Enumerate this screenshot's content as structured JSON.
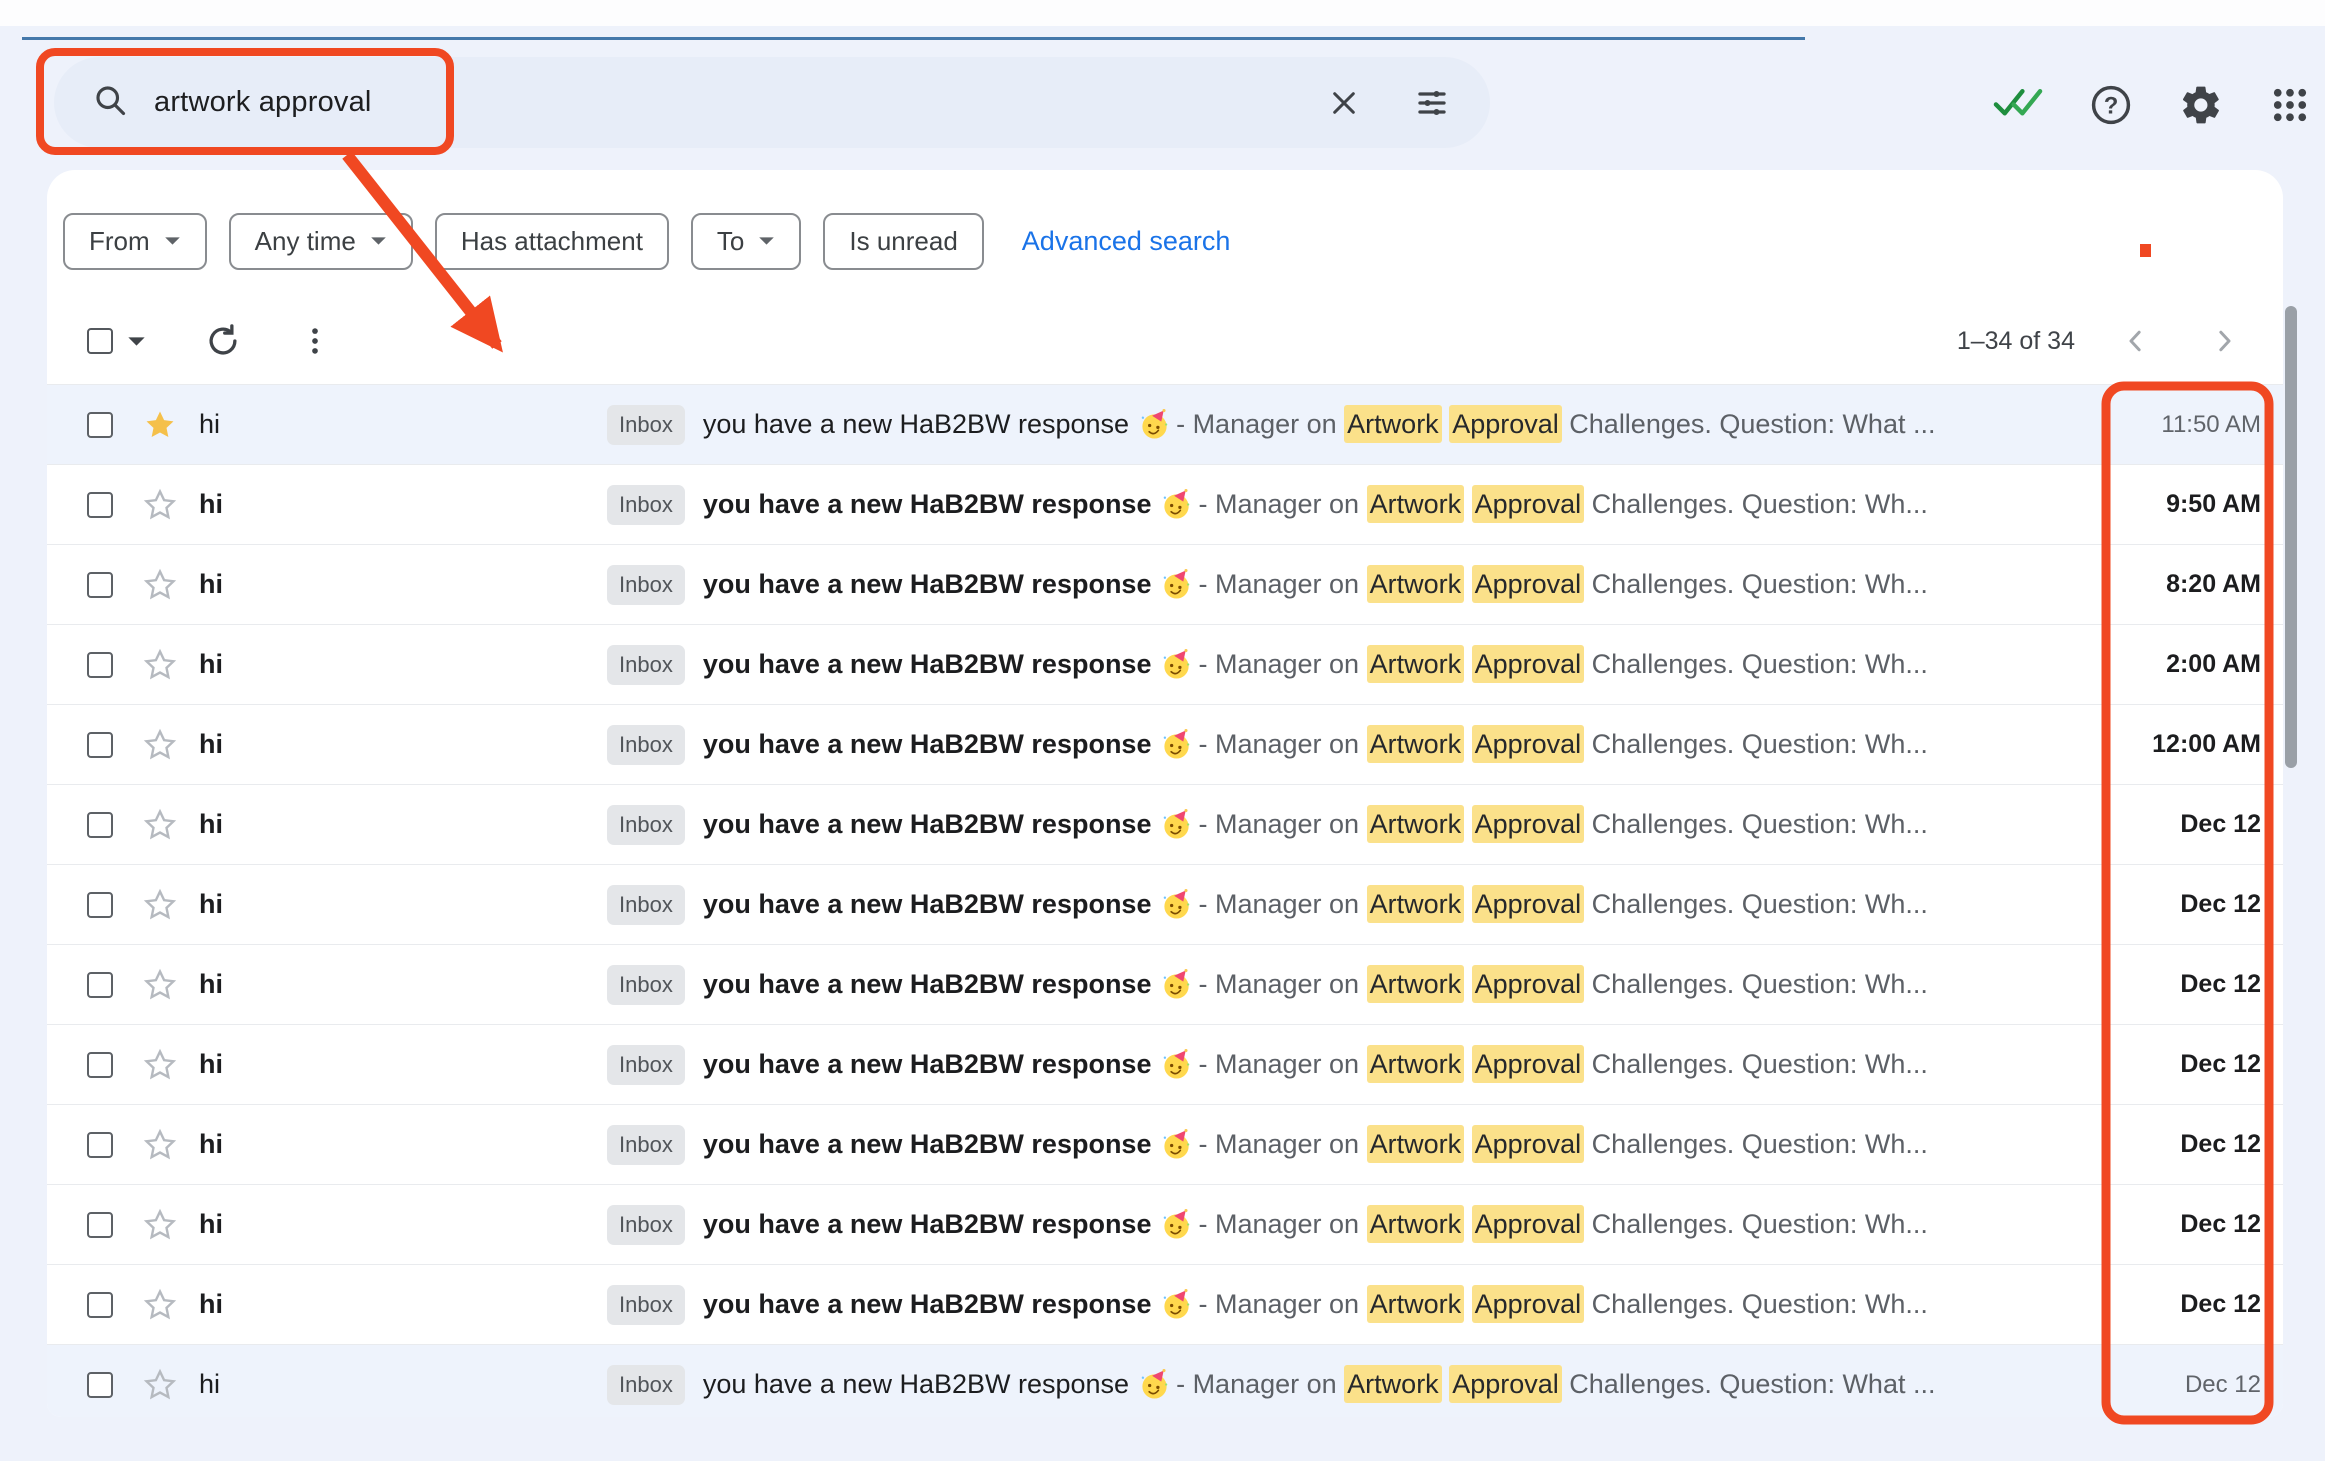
{
  "colors": {
    "accent_red": "#f04822",
    "highlight_yellow": "#fbe18a",
    "link_blue": "#1a73e8",
    "read_row_bg": "#eef3fc"
  },
  "search": {
    "query": "artwork approval",
    "icons": [
      "search-icon",
      "clear-icon",
      "search-options-sliders-icon"
    ]
  },
  "header": {
    "icons": [
      "double-checkmark-icon",
      "help-icon",
      "settings-gear-icon",
      "apps-grid-icon"
    ],
    "help_glyph": "?"
  },
  "chips": [
    {
      "label": "From",
      "dropdown": true
    },
    {
      "label": "Any time",
      "dropdown": true
    },
    {
      "label": "Has attachment",
      "dropdown": false
    },
    {
      "label": "To",
      "dropdown": true
    },
    {
      "label": "Is unread",
      "dropdown": false
    }
  ],
  "advanced_search_label": "Advanced search",
  "toolbar": {
    "pagination": "1–34 of 34",
    "icons": [
      "select-checkbox",
      "select-dropdown-caret",
      "refresh-icon",
      "more-options-icon",
      "prev-page-chevron",
      "next-page-chevron"
    ]
  },
  "emails": [
    {
      "sender": "hi",
      "label": "Inbox",
      "subject": "you have a new HaB2BW response",
      "emoji": "party-face",
      "snippet_prefix": "- Manager on ",
      "highlight1": "Artwork",
      "highlight2": "Approval",
      "snippet_suffix": " Challenges. Question: What ...",
      "time": "11:50 AM",
      "unread": false,
      "starred": true
    },
    {
      "sender": "hi",
      "label": "Inbox",
      "subject": "you have a new HaB2BW response",
      "emoji": "party-face",
      "snippet_prefix": "- Manager on ",
      "highlight1": "Artwork",
      "highlight2": "Approval",
      "snippet_suffix": " Challenges. Question: Wh...",
      "time": "9:50 AM",
      "unread": true,
      "starred": false
    },
    {
      "sender": "hi",
      "label": "Inbox",
      "subject": "you have a new HaB2BW response",
      "emoji": "party-face",
      "snippet_prefix": "- Manager on ",
      "highlight1": "Artwork",
      "highlight2": "Approval",
      "snippet_suffix": " Challenges. Question: Wh...",
      "time": "8:20 AM",
      "unread": true,
      "starred": false
    },
    {
      "sender": "hi",
      "label": "Inbox",
      "subject": "you have a new HaB2BW response",
      "emoji": "party-face",
      "snippet_prefix": "- Manager on ",
      "highlight1": "Artwork",
      "highlight2": "Approval",
      "snippet_suffix": " Challenges. Question: Wh...",
      "time": "2:00 AM",
      "unread": true,
      "starred": false
    },
    {
      "sender": "hi",
      "label": "Inbox",
      "subject": "you have a new HaB2BW response",
      "emoji": "party-face",
      "snippet_prefix": "- Manager on ",
      "highlight1": "Artwork",
      "highlight2": "Approval",
      "snippet_suffix": " Challenges. Question: Wh...",
      "time": "12:00 AM",
      "unread": true,
      "starred": false
    },
    {
      "sender": "hi",
      "label": "Inbox",
      "subject": "you have a new HaB2BW response",
      "emoji": "party-face",
      "snippet_prefix": "- Manager on ",
      "highlight1": "Artwork",
      "highlight2": "Approval",
      "snippet_suffix": " Challenges. Question: Wh...",
      "time": "Dec 12",
      "unread": true,
      "starred": false
    },
    {
      "sender": "hi",
      "label": "Inbox",
      "subject": "you have a new HaB2BW response",
      "emoji": "party-face",
      "snippet_prefix": "- Manager on ",
      "highlight1": "Artwork",
      "highlight2": "Approval",
      "snippet_suffix": " Challenges. Question: Wh...",
      "time": "Dec 12",
      "unread": true,
      "starred": false
    },
    {
      "sender": "hi",
      "label": "Inbox",
      "subject": "you have a new HaB2BW response",
      "emoji": "party-face",
      "snippet_prefix": "- Manager on ",
      "highlight1": "Artwork",
      "highlight2": "Approval",
      "snippet_suffix": " Challenges. Question: Wh...",
      "time": "Dec 12",
      "unread": true,
      "starred": false
    },
    {
      "sender": "hi",
      "label": "Inbox",
      "subject": "you have a new HaB2BW response",
      "emoji": "party-face",
      "snippet_prefix": "- Manager on ",
      "highlight1": "Artwork",
      "highlight2": "Approval",
      "snippet_suffix": " Challenges. Question: Wh...",
      "time": "Dec 12",
      "unread": true,
      "starred": false
    },
    {
      "sender": "hi",
      "label": "Inbox",
      "subject": "you have a new HaB2BW response",
      "emoji": "party-face",
      "snippet_prefix": "- Manager on ",
      "highlight1": "Artwork",
      "highlight2": "Approval",
      "snippet_suffix": " Challenges. Question: Wh...",
      "time": "Dec 12",
      "unread": true,
      "starred": false
    },
    {
      "sender": "hi",
      "label": "Inbox",
      "subject": "you have a new HaB2BW response",
      "emoji": "party-face",
      "snippet_prefix": "- Manager on ",
      "highlight1": "Artwork",
      "highlight2": "Approval",
      "snippet_suffix": " Challenges. Question: Wh...",
      "time": "Dec 12",
      "unread": true,
      "starred": false
    },
    {
      "sender": "hi",
      "label": "Inbox",
      "subject": "you have a new HaB2BW response",
      "emoji": "party-face",
      "snippet_prefix": "- Manager on ",
      "highlight1": "Artwork",
      "highlight2": "Approval",
      "snippet_suffix": " Challenges. Question: Wh...",
      "time": "Dec 12",
      "unread": true,
      "starred": false
    },
    {
      "sender": "hi",
      "label": "Inbox",
      "subject": "you have a new HaB2BW response",
      "emoji": "party-face",
      "snippet_prefix": "- Manager on ",
      "highlight1": "Artwork",
      "highlight2": "Approval",
      "snippet_suffix": " Challenges. Question: What ...",
      "time": "Dec 12",
      "unread": false,
      "starred": false
    }
  ],
  "annotations": [
    "red-box-search",
    "red-arrow-to-first-email",
    "red-box-date-column"
  ]
}
